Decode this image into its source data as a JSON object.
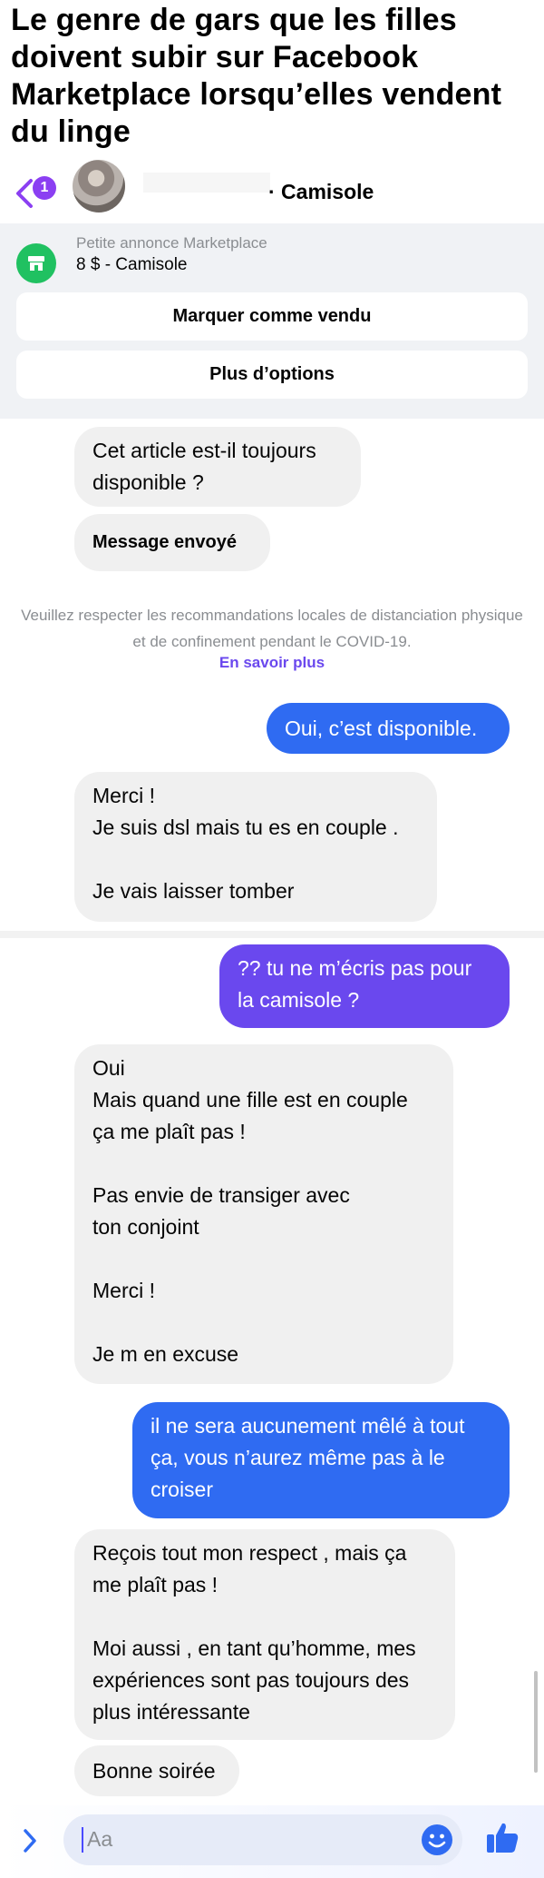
{
  "meme": {
    "title": "Le genre de gars que les filles doivent subir sur Facebook Marketplace lorsqu’elles vendent du linge"
  },
  "header": {
    "unread_count": "1",
    "chat_name": "· Camisole"
  },
  "marketplace": {
    "label": "Petite annonce Marketplace",
    "item": "8 $ - Camisole",
    "mark_sold": "Marquer comme vendu",
    "more_options": "Plus d’options"
  },
  "messages": {
    "m1": "Cet article est-il toujours\ndisponible ?",
    "m2": "Message envoyé",
    "notice": "Veuillez respecter les recommandations locales de distanciation physique et de confinement pendant le COVID-19.",
    "notice_link": "En savoir plus",
    "m3": "Oui, c’est disponible.",
    "m4": "Merci !\nJe suis dsl mais tu es en couple .\n\nJe vais laisser tomber",
    "m5": "?? tu ne m’écris pas pour\nla camisole ?",
    "m6": "Oui\nMais quand une fille est en couple\nça me plaît pas !\n\nPas envie de transiger avec\nton conjoint\n\nMerci !\n\nJe m en excuse",
    "m7": "il ne sera aucunement mêlé à tout\nça, vous n’aurez même pas à le\ncroiser",
    "m8": "Reçois tout mon respect , mais ça\nme plaît pas !\n\nMoi aussi , en tant qu’homme, mes\nexpériences sont pas toujours des\nplus intéressante",
    "m9": "Bonne soirée"
  },
  "composer": {
    "placeholder": "Aa"
  },
  "icons": {
    "back": "chevron-left-icon",
    "store": "store-icon",
    "expand": "chevron-right-icon",
    "emoji": "smiley-icon",
    "like": "thumbs-up-icon"
  },
  "colors": {
    "accent_purple": "#8b3ff2",
    "bubble_blue": "#2f6bf2",
    "bubble_purple": "#6a48ee",
    "bubble_gray": "#f0f0f0",
    "marketplace_green": "#20c161"
  }
}
